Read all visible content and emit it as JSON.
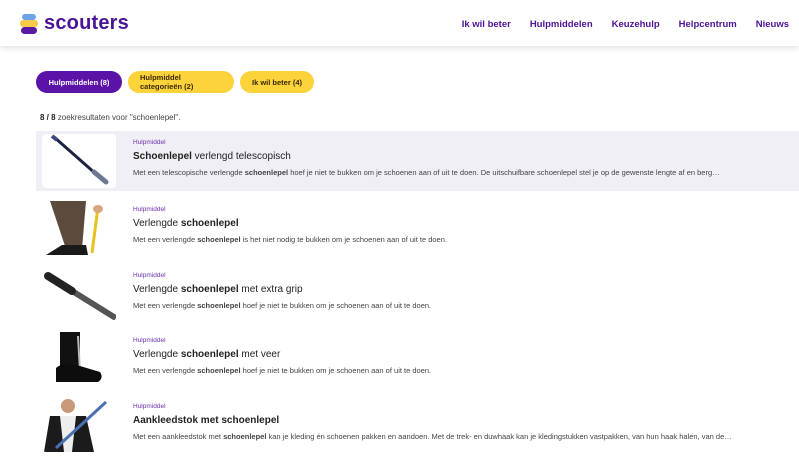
{
  "header": {
    "logo_text": "scouters",
    "nav": [
      "Ik wil beter",
      "Hulpmiddelen",
      "Keuzehulp",
      "Helpcentrum",
      "Nieuws"
    ]
  },
  "filters": [
    {
      "label": "Hulpmiddelen (8)",
      "active": true
    },
    {
      "label": "Hulpmiddel categorieën (2)",
      "active": false
    },
    {
      "label": "Ik wil beter (4)",
      "active": false
    }
  ],
  "results_count": {
    "shown": "8 / 8",
    "suffix": " zoekresultaten voor \"schoenlepel\"."
  },
  "results": [
    {
      "category": "Hulpmiddel",
      "title_bold": "Schoenlepel",
      "title_rest": " verlengd telescopisch",
      "desc_pre": "Met een telescopische verlengde ",
      "desc_bold": "schoenlepel",
      "desc_post": " hoef je niet te bukken om je schoenen aan of uit te doen. De uitschuifbare schoenlepel stel je op de gewenste lengte af en berg…",
      "image": "telescopic-shoehorn"
    },
    {
      "category": "Hulpmiddel",
      "title_pre": "Verlengde ",
      "title_bold": "schoenlepel",
      "title_rest": "",
      "desc_pre": "Met een verlengde ",
      "desc_bold": "schoenlepel",
      "desc_post": " is het niet nodig te bukken om je schoenen aan of uit te doen.",
      "image": "person-using-yellow-shoehorn"
    },
    {
      "category": "Hulpmiddel",
      "title_pre": "Verlengde ",
      "title_bold": "schoenlepel",
      "title_rest": " met extra grip",
      "desc_pre": "Met een verlengde ",
      "desc_bold": "schoenlepel",
      "desc_post": " hoef je niet te bukken om je schoenen aan of uit te doen.",
      "image": "grip-shoehorn"
    },
    {
      "category": "Hulpmiddel",
      "title_pre": "Verlengde ",
      "title_bold": "schoenlepel",
      "title_rest": " met veer",
      "desc_pre": "Met een verlengde ",
      "desc_bold": "schoenlepel",
      "desc_post": " hoef je niet te bukken om je schoenen aan of uit te doen.",
      "image": "shoe-with-spring-shoehorn"
    },
    {
      "category": "Hulpmiddel",
      "title_pre": "Aankleedstok met ",
      "title_bold": "schoenlepel",
      "title_rest": "",
      "desc_pre": "Met een aankleedstok met ",
      "desc_bold": "schoenlepel",
      "desc_post": " kan je kleding én schoenen pakken en aandoen. Met de trek- en duwhaak kan je kledingstukken vastpakken, van hun haak halen, van de…",
      "image": "man-with-dressing-stick"
    }
  ]
}
